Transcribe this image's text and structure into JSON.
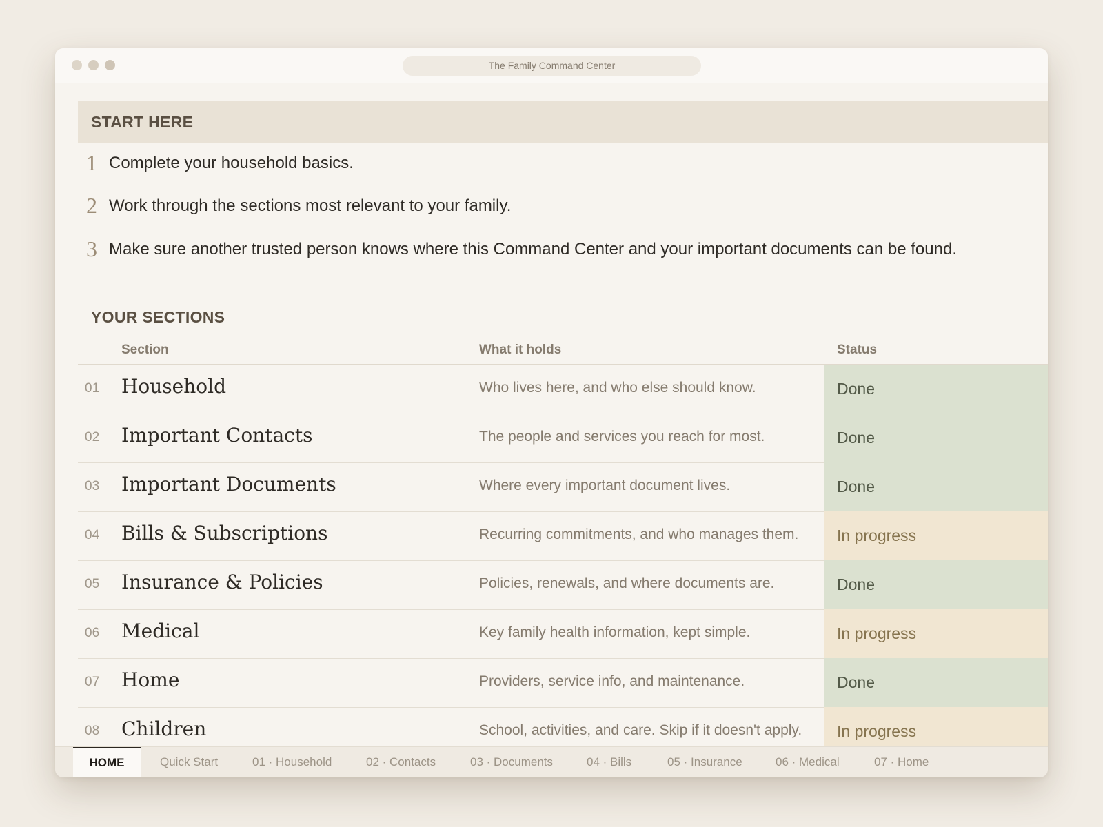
{
  "window": {
    "title": "The Family Command Center"
  },
  "start_here": {
    "heading": "START HERE",
    "steps": [
      {
        "num": "1",
        "text": "Complete your household basics."
      },
      {
        "num": "2",
        "text": "Work through the sections most relevant to your family."
      },
      {
        "num": "3",
        "text": "Make sure another trusted person knows where this Command Center and your important documents can be found."
      }
    ]
  },
  "sections": {
    "heading": "YOUR SECTIONS",
    "columns": {
      "section": "Section",
      "what": "What it holds",
      "status": "Status"
    },
    "rows": [
      {
        "num": "01",
        "name": "Household",
        "desc": "Who lives here, and who else should know.",
        "status": "Done"
      },
      {
        "num": "02",
        "name": "Important Contacts",
        "desc": "The people and services you reach for most.",
        "status": "Done"
      },
      {
        "num": "03",
        "name": "Important Documents",
        "desc": "Where every important document lives.",
        "status": "Done"
      },
      {
        "num": "04",
        "name": "Bills & Subscriptions",
        "desc": "Recurring commitments, and who manages them.",
        "status": "In progress"
      },
      {
        "num": "05",
        "name": "Insurance & Policies",
        "desc": "Policies, renewals, and where documents are.",
        "status": "Done"
      },
      {
        "num": "06",
        "name": "Medical",
        "desc": "Key family health information, kept simple.",
        "status": "In progress"
      },
      {
        "num": "07",
        "name": "Home",
        "desc": "Providers, service info, and maintenance.",
        "status": "Done"
      },
      {
        "num": "08",
        "name": "Children",
        "desc": "School, activities, and care. Skip if it doesn't apply.",
        "status": "In progress"
      }
    ]
  },
  "tabs": [
    {
      "label": "HOME",
      "active": true
    },
    {
      "label": "Quick Start"
    },
    {
      "label": "01 · Household"
    },
    {
      "label": "02 · Contacts"
    },
    {
      "label": "03 · Documents"
    },
    {
      "label": "04 · Bills"
    },
    {
      "label": "05 · Insurance"
    },
    {
      "label": "06 · Medical"
    },
    {
      "label": "07 · Home"
    }
  ],
  "colors": {
    "done": "#dbe1d0",
    "in_progress": "#f1e6d2",
    "banner": "#e9e2d6",
    "background": "#f1ece4"
  }
}
